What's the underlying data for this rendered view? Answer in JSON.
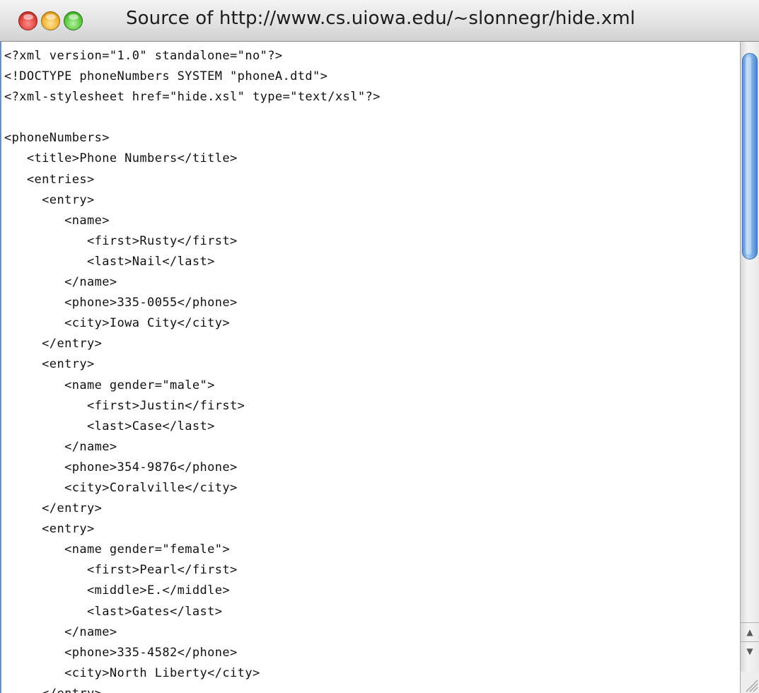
{
  "window": {
    "title": "Source of http://www.cs.uiowa.edu/~slonnegr/hide.xml"
  },
  "source_lines": [
    "<?xml version=\"1.0\" standalone=\"no\"?>",
    "<!DOCTYPE phoneNumbers SYSTEM \"phoneA.dtd\">",
    "<?xml-stylesheet href=\"hide.xsl\" type=\"text/xsl\"?>",
    "",
    "<phoneNumbers>",
    "   <title>Phone Numbers</title>",
    "   <entries>",
    "     <entry>",
    "        <name>",
    "           <first>Rusty</first>",
    "           <last>Nail</last>",
    "        </name>",
    "        <phone>335-0055</phone>",
    "        <city>Iowa City</city>",
    "     </entry>",
    "     <entry>",
    "        <name gender=\"male\">",
    "           <first>Justin</first>",
    "           <last>Case</last>",
    "        </name>",
    "        <phone>354-9876</phone>",
    "        <city>Coralville</city>",
    "     </entry>",
    "     <entry>",
    "        <name gender=\"female\">",
    "           <first>Pearl</first>",
    "           <middle>E.</middle>",
    "           <last>Gates</last>",
    "        </name>",
    "        <phone>335-4582</phone>",
    "        <city>North Liberty</city>",
    "     </entry>"
  ],
  "scrollbar": {
    "up_arrow": "▲",
    "down_arrow": "▼",
    "position": 0.0
  },
  "icons": {
    "close": "close-icon",
    "minimize": "minimize-icon",
    "zoom": "zoom-icon",
    "resize": "resize-grip-icon"
  }
}
